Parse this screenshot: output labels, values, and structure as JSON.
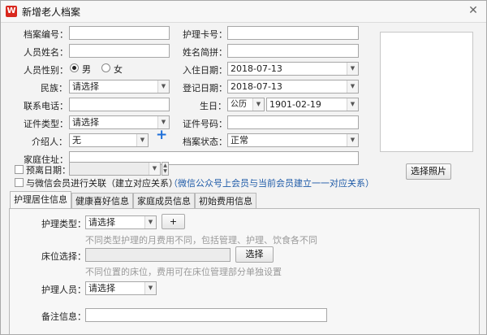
{
  "window": {
    "title": "新增老人档案",
    "close_glyph": "✕"
  },
  "form": {
    "archive_no_label": "档案编号：",
    "name_label": "人员姓名：",
    "gender_label": "人员性别：",
    "gender_male": "男",
    "gender_female": "女",
    "ethnicity_label": "民族：",
    "ethnicity_value": "请选择",
    "phone_label": "联系电话：",
    "id_type_label": "证件类型：",
    "id_type_value": "请选择",
    "introducer_label": "介绍人：",
    "introducer_value": "无",
    "address_label": "家庭住址：",
    "leave_date_label": "预离日期：",
    "care_card_label": "护理卡号：",
    "pinyin_label": "姓名简拼：",
    "checkin_label": "入住日期：",
    "checkin_value": "2018-07-13",
    "register_label": "登记日期：",
    "register_value": "2018-07-13",
    "birthday_label": "生日：",
    "calendar_value": "公历",
    "birthday_value": "1901-02-19",
    "id_no_label": "证件号码：",
    "status_label": "档案状态：",
    "status_value": "正常",
    "wechat_link_label": "与微信会员进行关联（建立对应关系）",
    "wechat_hint": "（微信公众号上会员与当前会员建立一一对应关系）",
    "photo_button": "选择照片"
  },
  "tabs": [
    {
      "label": "护理居住信息"
    },
    {
      "label": "健康喜好信息"
    },
    {
      "label": "家庭成员信息"
    },
    {
      "label": "初始费用信息"
    }
  ],
  "panel": {
    "care_type_label": "护理类型：",
    "care_type_value": "请选择",
    "add_button": "+",
    "care_type_hint": "不同类型护理的月费用不同，包括管理、护理、饮食各不同",
    "bed_label": "床位选择：",
    "bed_button": "选择",
    "bed_hint": "不同位置的床位，费用可在床位管理部分单独设置",
    "nurse_label": "护理人员：",
    "nurse_value": "请选择",
    "remark_label": "备注信息："
  }
}
